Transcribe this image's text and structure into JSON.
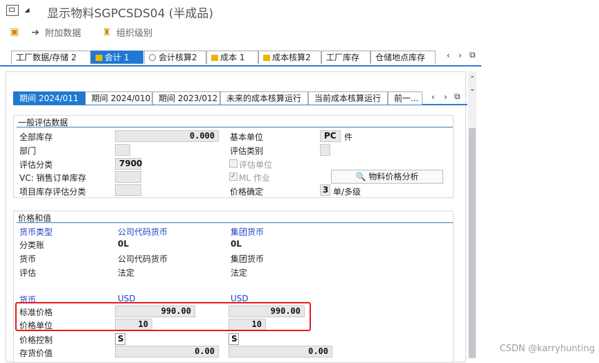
{
  "window": {
    "title": "显示物料SGPCSDS04 (半成品)"
  },
  "toolbar": {
    "additional_data": "附加数据",
    "org_levels": "组织级别"
  },
  "outer_tabs": [
    "工厂数据/存储 2",
    "会计 1",
    "会计核算2",
    "成本 1",
    "成本核算2",
    "工厂库存",
    "仓储地点库存"
  ],
  "inner_tabs": [
    "期间 2024/011",
    "期间 2024/010",
    "期间 2023/012",
    "未来的成本核算运行",
    "当前成本核算运行",
    "前一..."
  ],
  "general": {
    "title": "一般评估数据",
    "total_stock_label": "全部库存",
    "total_stock": "0.000",
    "base_unit_label": "基本单位",
    "base_unit": "PC",
    "base_unit_text": "件",
    "division_label": "部门",
    "division": "",
    "valuation_category_label": "评估类别",
    "valuation_category": "",
    "valuation_class_label": "评估分类",
    "valuation_class": "7900",
    "valuated_unit_label": "评估单位",
    "vc_sales_label": "VC: 销售订单库存",
    "vc_sales": "",
    "ml_active_label": "ML 作业",
    "analysis_button": "物料价格分析",
    "project_stock_label": "项目库存评估分类",
    "project_stock": "",
    "price_determination_label": "价格确定",
    "price_determination": "3",
    "price_determination_text": "单/多级"
  },
  "prices": {
    "title": "价格和值",
    "currency_type_label": "货币类型",
    "company_code_currency": "公司代码货币",
    "group_currency": "集团货币",
    "ledger_label": "分类账",
    "ledger_1": "0L",
    "ledger_2": "0L",
    "currency_label": "货币",
    "currency_val_1": "公司代码货币",
    "currency_val_2": "集团货币",
    "valuation_label": "评估",
    "valuation_1": "法定",
    "valuation_2": "法定",
    "currency_blue_label": "货币",
    "usd_1": "USD",
    "usd_2": "USD",
    "standard_price_label": "标准价格",
    "standard_price_1": "990.00",
    "standard_price_2": "990.00",
    "price_unit_label": "价格单位",
    "price_unit_1": "10",
    "price_unit_2": "10",
    "price_control_label": "价格控制",
    "price_control_1": "S",
    "price_control_2": "S",
    "inventory_value_label": "存货价值",
    "inventory_value_1": "0.00",
    "inventory_value_2": "0.00"
  },
  "watermark": "CSDN @karryhunting"
}
